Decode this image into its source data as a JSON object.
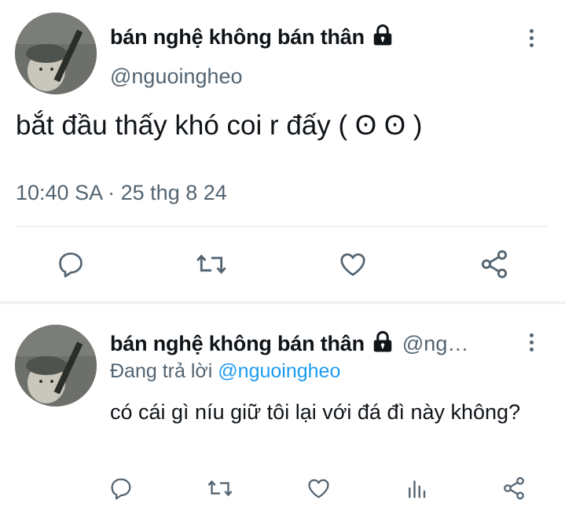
{
  "main_tweet": {
    "display_name": "bán nghệ không bán thân",
    "handle": "@nguoingheo",
    "text": "bắt đầu thấy khó coi r đấy ( ʘ ʘ )",
    "time": "10:40 SA",
    "separator": "·",
    "date": "25 thg 8 24"
  },
  "reply_tweet": {
    "display_name": "bán nghệ không bán thân",
    "handle": "@ng…",
    "replying_prefix": "Đang trả lời",
    "replying_mention": "@nguoingheo",
    "text": "có cái gì níu giữ tôi lại với đá đì này không?"
  },
  "icons": {
    "reply": "reply-icon",
    "retweet": "retweet-icon",
    "like": "heart-icon",
    "share": "share-icon",
    "views": "analytics-icon",
    "lock": "lock-icon",
    "more": "more-vertical-icon"
  },
  "colors": {
    "text": "#0f1419",
    "secondary": "#536471",
    "link": "#1d9bf0",
    "divider": "#eff3f4"
  }
}
